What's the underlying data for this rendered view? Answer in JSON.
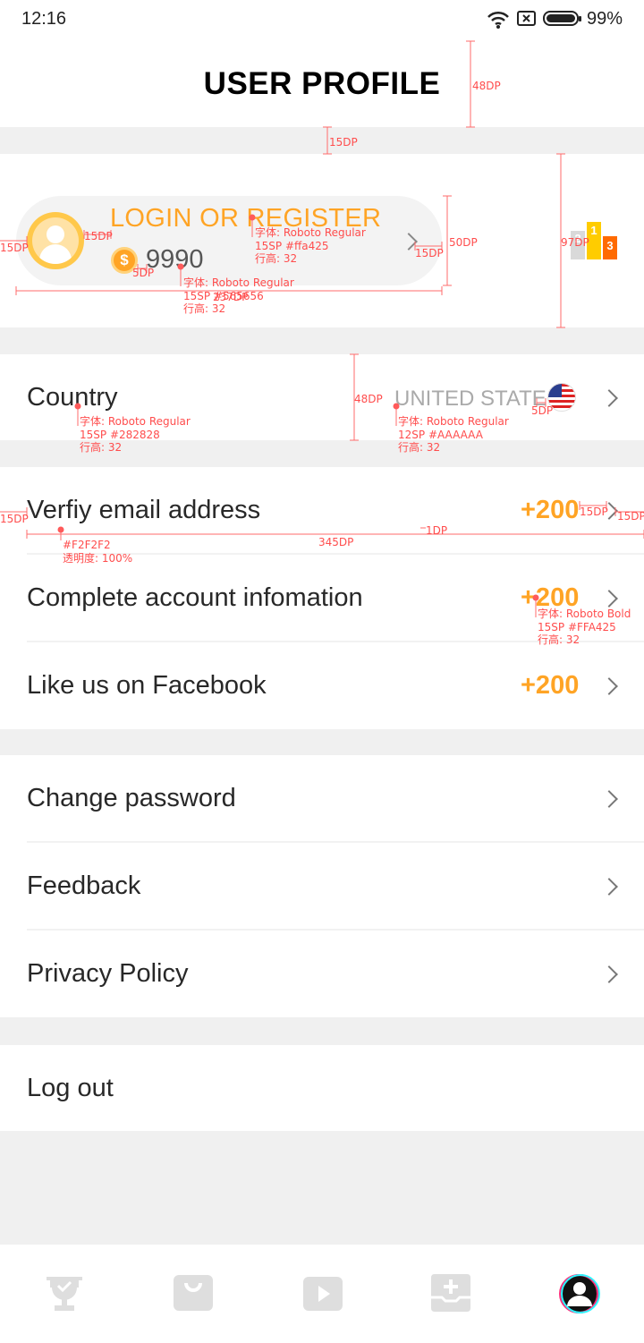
{
  "status_bar": {
    "time": "12:16",
    "battery": "99%",
    "icons": [
      "wifi-icon",
      "sim-icon",
      "battery-icon"
    ]
  },
  "header": {
    "title": "USER PROFILE"
  },
  "profile": {
    "login_label": "LOGIN OR REGISTER",
    "coins": "9990",
    "coin_symbol": "$"
  },
  "rank_badges": [
    "2",
    "1",
    "3"
  ],
  "country": {
    "label": "Country",
    "value": "UNITED STATE"
  },
  "tasks": [
    {
      "label": "Verfiy email address",
      "bonus": "+200"
    },
    {
      "label": "Complete account infomation",
      "bonus": "+200"
    },
    {
      "label": "Like us on Facebook",
      "bonus": "+200"
    }
  ],
  "settings": [
    {
      "label": "Change password"
    },
    {
      "label": "Feedback"
    },
    {
      "label": "Privacy Policy"
    }
  ],
  "logout": {
    "label": "Log out"
  },
  "tabbar": {
    "items": [
      "trophy-icon",
      "shop-icon",
      "play-icon",
      "add-icon",
      "profile-icon"
    ]
  },
  "annotations": {
    "a48dp": "48DP",
    "a15dp_gap": "15DP",
    "a97dp": "97DP",
    "a50dp": "50DP",
    "a15dp_left": "15DP",
    "a15dp_avatar": "15DP",
    "a5dp_coin": "5DP",
    "a15dp_arrow": "15DP",
    "a237dp": "237DP",
    "login_font": "字体: Roboto Regular",
    "login_size": "15SP #ffa425",
    "login_lh": "行高: 32",
    "coin_font": "字体: Roboto Regular",
    "coin_size": "15SP #565656",
    "coin_lh": "行高: 32",
    "a48dp_row": "48DP",
    "country_font": "字体: Roboto Regular",
    "country_size": "15SP #282828",
    "country_lh": "行高: 32",
    "value_font": "字体: Roboto Regular",
    "value_size": "12SP #AAAAAA",
    "value_lh": "行高: 32",
    "a5dp_flag": "5DP",
    "a15dp_row_left": "15DP",
    "a15dp_bonus": "15DP",
    "a15dp_row_right": "15DP",
    "divider_color": "#F2F2F2",
    "divider_opacity": "透明度: 100%",
    "a345dp": "345DP",
    "a1dp": "1DP",
    "bonus_font": "字体: Roboto Bold",
    "bonus_size": "15SP #FFA425",
    "bonus_lh": "行高: 32"
  }
}
